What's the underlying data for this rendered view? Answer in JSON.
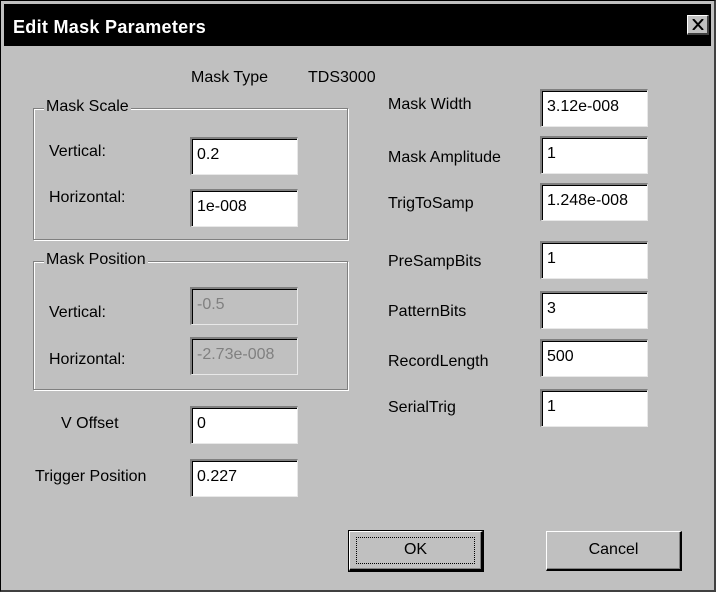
{
  "window": {
    "title": "Edit Mask Parameters",
    "close_icon": "close-icon"
  },
  "mask_type": {
    "label": "Mask Type",
    "value": "TDS3000"
  },
  "mask_scale": {
    "legend": "Mask Scale",
    "vertical_label": "Vertical:",
    "vertical_value": "0.2",
    "horizontal_label": "Horizontal:",
    "horizontal_value": "1e-008"
  },
  "mask_position": {
    "legend": "Mask Position",
    "vertical_label": "Vertical:",
    "vertical_value": "-0.5",
    "horizontal_label": "Horizontal:",
    "horizontal_value": "-2.73e-008"
  },
  "v_offset": {
    "label": "V Offset",
    "value": "0"
  },
  "trigger_position": {
    "label": "Trigger Position",
    "value": "0.227"
  },
  "right": {
    "mask_width": {
      "label": "Mask Width",
      "value": "3.12e-008"
    },
    "mask_amplitude": {
      "label": "Mask Amplitude",
      "value": "1"
    },
    "trig_to_samp": {
      "label": "TrigToSamp",
      "value": "1.248e-008"
    },
    "pre_samp_bits": {
      "label": "PreSampBits",
      "value": "1"
    },
    "pattern_bits": {
      "label": "PatternBits",
      "value": "3"
    },
    "record_length": {
      "label": "RecordLength",
      "value": "500"
    },
    "serial_trig": {
      "label": "SerialTrig",
      "value": "1"
    }
  },
  "buttons": {
    "ok": "OK",
    "cancel": "Cancel"
  }
}
